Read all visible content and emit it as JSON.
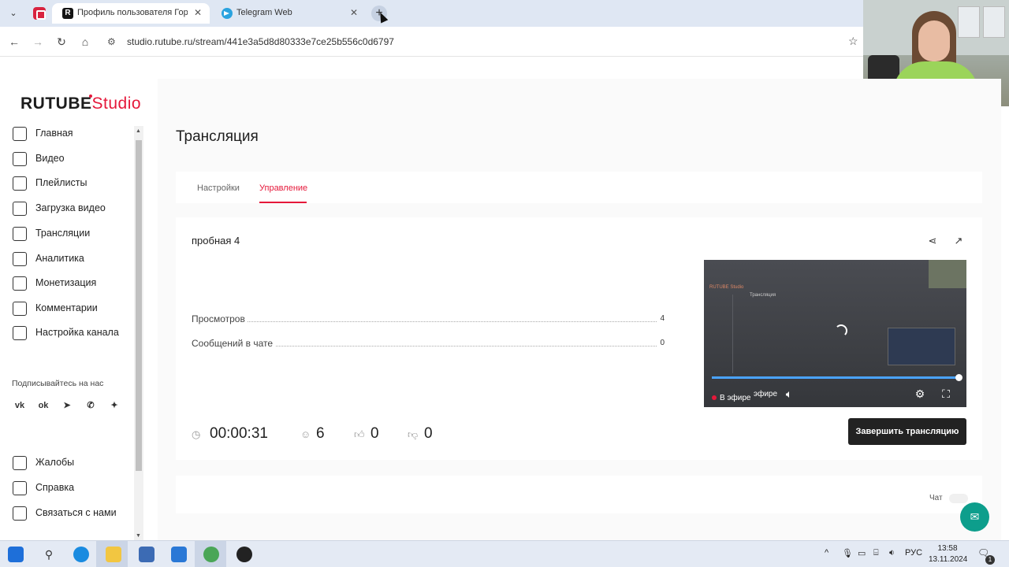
{
  "browser": {
    "tabs": [
      {
        "title": "Профиль пользователя Город"
      },
      {
        "title": "Telegram Web"
      }
    ],
    "new_tab": "+",
    "close_glyph": "✕",
    "url": "studio.rutube.ru/stream/441e3a5d8d80333e7ce25b556c0d6797"
  },
  "app": {
    "logo_main": "RUTUBE",
    "logo_sub": "Studio",
    "accent_color": "#e5183a"
  },
  "sidebar": {
    "items": [
      {
        "label": "Главная",
        "icon": "home-icon"
      },
      {
        "label": "Видео",
        "icon": "video-icon"
      },
      {
        "label": "Плейлисты",
        "icon": "playlist-icon"
      },
      {
        "label": "Загрузка видео",
        "icon": "upload-icon"
      },
      {
        "label": "Трансляции",
        "icon": "broadcast-icon"
      },
      {
        "label": "Аналитика",
        "icon": "analytics-icon"
      },
      {
        "label": "Монетизация",
        "icon": "monetization-icon"
      },
      {
        "label": "Комментарии",
        "icon": "comments-icon"
      },
      {
        "label": "Настройка канала",
        "icon": "channel-settings-icon"
      }
    ],
    "follow_label": "Подписывайтесь на нас",
    "socials": [
      "vk-icon",
      "ok-icon",
      "telegram-icon",
      "viber-icon",
      "dzen-icon"
    ],
    "bottom_items": [
      {
        "label": "Жалобы",
        "icon": "complaints-icon"
      },
      {
        "label": "Справка",
        "icon": "help-icon"
      },
      {
        "label": "Связаться с нами",
        "icon": "contact-icon"
      }
    ]
  },
  "page": {
    "title": "Трансляция",
    "tabs": [
      {
        "label": "Настройки",
        "active": false
      },
      {
        "label": "Управление",
        "active": true
      }
    ]
  },
  "stream": {
    "name": "пробная 4",
    "stats": [
      {
        "label": "Просмотров",
        "value": "4"
      },
      {
        "label": "Сообщений в чате",
        "value": "0"
      }
    ],
    "duration": "00:00:31",
    "viewers": "6",
    "likes": "0",
    "dislikes": "0",
    "end_button": "Завершить трансляцию"
  },
  "player": {
    "live_label": "В эфире",
    "live_label_partial": "эфире",
    "progress_fraction": 1.0,
    "mini_logo": "RUTUBE Studio",
    "mini_title": "Трансляция"
  },
  "chat": {
    "label": "Чат",
    "enabled": false
  },
  "taskbar": {
    "language": "РУС",
    "time": "13:58",
    "date": "13.11.2024",
    "notification_count": "1"
  }
}
